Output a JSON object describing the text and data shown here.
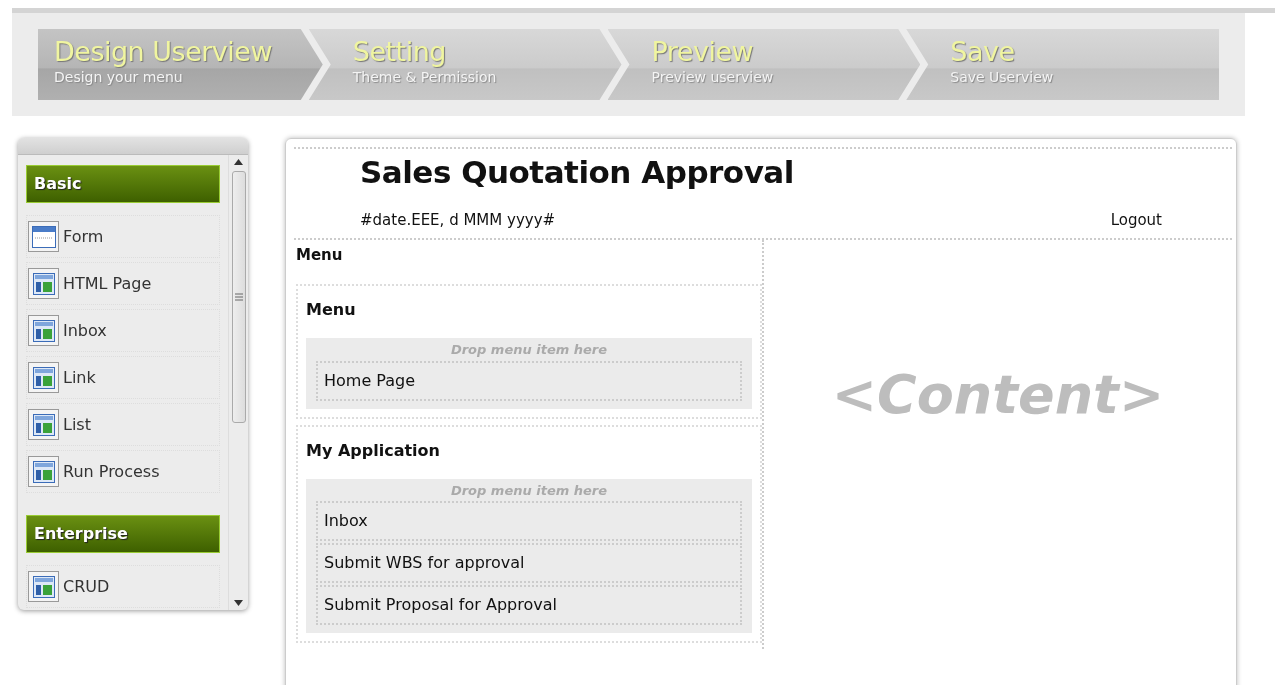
{
  "wizard": [
    {
      "title": "Design Userview",
      "subtitle": "Design your menu",
      "selected": true
    },
    {
      "title": "Setting",
      "subtitle": "Theme & Permission",
      "selected": false
    },
    {
      "title": "Preview",
      "subtitle": "Preview userview",
      "selected": false
    },
    {
      "title": "Save",
      "subtitle": "Save Userview",
      "selected": false
    }
  ],
  "palette": [
    {
      "heading": "Basic",
      "items": [
        {
          "label": "Form",
          "kind": "form"
        },
        {
          "label": "HTML Page",
          "kind": "page"
        },
        {
          "label": "Inbox",
          "kind": "page"
        },
        {
          "label": "Link",
          "kind": "page"
        },
        {
          "label": "List",
          "kind": "page"
        },
        {
          "label": "Run Process",
          "kind": "page"
        }
      ]
    },
    {
      "heading": "Enterprise",
      "items": [
        {
          "label": "CRUD",
          "kind": "page"
        }
      ]
    }
  ],
  "canvas": {
    "title": "Sales Quotation Approval",
    "date": "#date.EEE, d MMM yyyy#",
    "logout": "Logout",
    "menu_heading": "Menu",
    "categories": [
      {
        "label": "Menu",
        "drop_hint": "Drop menu item here",
        "items": [
          "Home Page"
        ]
      },
      {
        "label": "My Application",
        "drop_hint": "Drop menu item here",
        "items": [
          "Inbox",
          "Submit WBS for approval",
          "Submit Proposal for Approval"
        ]
      }
    ],
    "content_placeholder": "<Content>"
  }
}
